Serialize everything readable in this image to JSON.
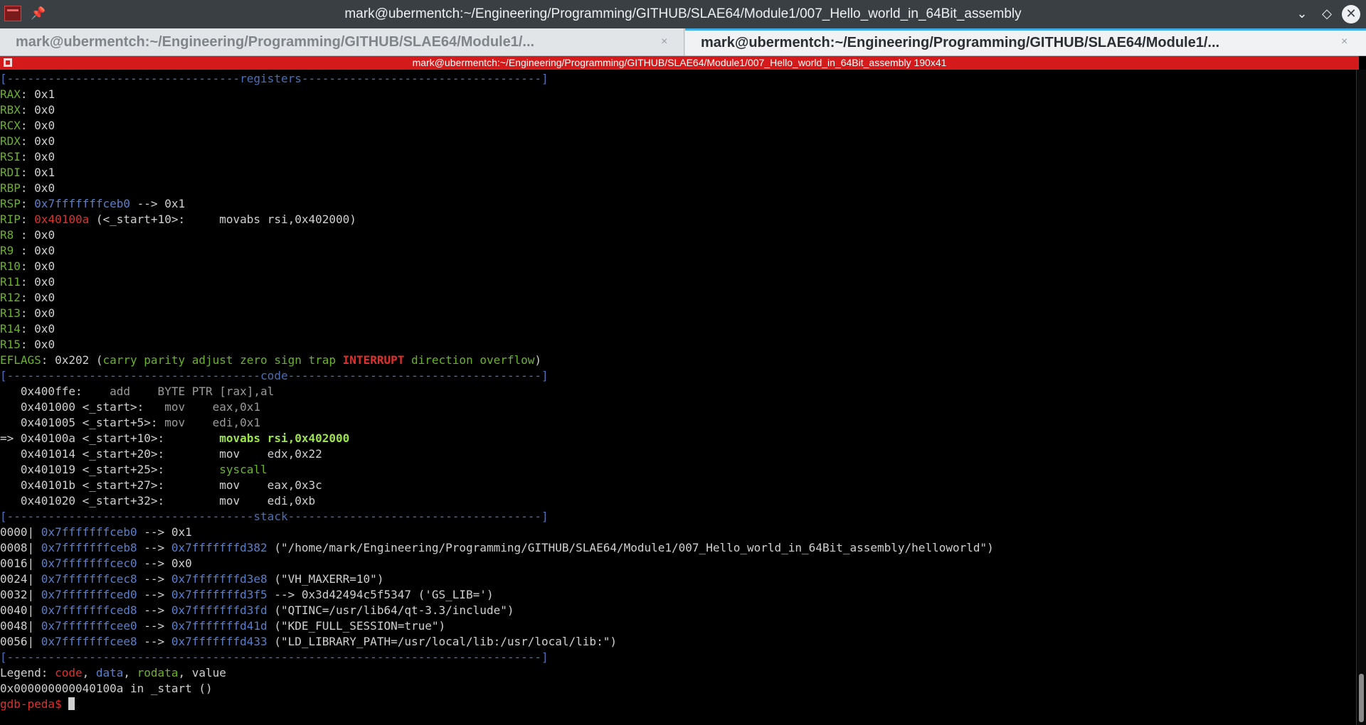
{
  "window": {
    "title": "mark@ubermentch:~/Engineering/Programming/GITHUB/SLAE64/Module1/007_Hello_world_in_64Bit_assembly"
  },
  "tabs": [
    {
      "label": "mark@ubermentch:~/Engineering/Programming/GITHUB/SLAE64/Module1/...",
      "close": "×"
    },
    {
      "label": "mark@ubermentch:~/Engineering/Programming/GITHUB/SLAE64/Module1/...",
      "close": "×"
    }
  ],
  "session": {
    "title": "mark@ubermentch:~/Engineering/Programming/GITHUB/SLAE64/Module1/007_Hello_world_in_64Bit_assembly 190x41"
  },
  "terminal": {
    "sep_registers": "[----------------------------------registers-----------------------------------]",
    "registers": [
      {
        "name": "RAX",
        "value": "0x1"
      },
      {
        "name": "RBX",
        "value": "0x0"
      },
      {
        "name": "RCX",
        "value": "0x0"
      },
      {
        "name": "RDX",
        "value": "0x0"
      },
      {
        "name": "RSI",
        "value": "0x0"
      },
      {
        "name": "RDI",
        "value": "0x1"
      },
      {
        "name": "RBP",
        "value": "0x0"
      }
    ],
    "rsp": {
      "name": "RSP",
      "addr": "0x7fffffffceb0",
      "rest": " --> 0x1"
    },
    "rip": {
      "name": "RIP",
      "addr": "0x40100a",
      "rest": " (<_start+10>:     movabs rsi,0x402000)"
    },
    "registers2": [
      {
        "name": "R8 ",
        "value": "0x0"
      },
      {
        "name": "R9 ",
        "value": "0x0"
      },
      {
        "name": "R10",
        "value": "0x0"
      },
      {
        "name": "R11",
        "value": "0x0"
      },
      {
        "name": "R12",
        "value": "0x0"
      },
      {
        "name": "R13",
        "value": "0x0"
      },
      {
        "name": "R14",
        "value": "0x0"
      },
      {
        "name": "R15",
        "value": "0x0"
      }
    ],
    "eflags": {
      "name": "EFLAGS",
      "value": ": 0x202 (",
      "flags_a": "carry parity adjust zero sign trap",
      "flag_hl": "INTERRUPT",
      "flags_b": "direction overflow",
      "close": ")"
    },
    "sep_code": "[-------------------------------------code-------------------------------------]",
    "code": [
      {
        "prefix": "   0x400ffe:    ",
        "instr": "add    BYTE PTR [rax],al",
        "style": "gray"
      },
      {
        "prefix": "   0x401000 <_start>:   ",
        "instr": "mov    eax,0x1",
        "style": "gray"
      },
      {
        "prefix": "   0x401005 <_start+5>: ",
        "instr": "mov    edi,0x1",
        "style": "gray"
      },
      {
        "prefix": "=> 0x40100a <_start+10>:        ",
        "instr": "movabs rsi,0x402000",
        "style": "hl"
      },
      {
        "prefix": "   0x401014 <_start+20>:        ",
        "instr": "mov    edx,0x22",
        "style": "plain"
      },
      {
        "prefix": "   0x401019 <_start+25>:        ",
        "instr": "syscall",
        "style": "grn"
      },
      {
        "prefix": "   0x40101b <_start+27>:        ",
        "instr": "mov    eax,0x3c",
        "style": "plain"
      },
      {
        "prefix": "   0x401020 <_start+32>:        ",
        "instr": "mov    edi,0xb",
        "style": "plain"
      }
    ],
    "sep_stack": "[------------------------------------stack-------------------------------------]",
    "stack": [
      {
        "off": "0000| ",
        "addr": "0x7fffffffceb0",
        "arrow": " --> ",
        "ptr": "",
        "rest": "0x1"
      },
      {
        "off": "0008| ",
        "addr": "0x7fffffffceb8",
        "arrow": " --> ",
        "ptr": "0x7fffffffd382",
        "rest": " (\"/home/mark/Engineering/Programming/GITHUB/SLAE64/Module1/007_Hello_world_in_64Bit_assembly/helloworld\")"
      },
      {
        "off": "0016| ",
        "addr": "0x7fffffffcec0",
        "arrow": " --> ",
        "ptr": "",
        "rest": "0x0"
      },
      {
        "off": "0024| ",
        "addr": "0x7fffffffcec8",
        "arrow": " --> ",
        "ptr": "0x7fffffffd3e8",
        "rest": " (\"VH_MAXERR=10\")"
      },
      {
        "off": "0032| ",
        "addr": "0x7fffffffced0",
        "arrow": " --> ",
        "ptr": "0x7fffffffd3f5",
        "rest": " --> 0x3d42494c5f5347 ('GS_LIB=')"
      },
      {
        "off": "0040| ",
        "addr": "0x7fffffffced8",
        "arrow": " --> ",
        "ptr": "0x7fffffffd3fd",
        "rest": " (\"QTINC=/usr/lib64/qt-3.3/include\")"
      },
      {
        "off": "0048| ",
        "addr": "0x7fffffffcee0",
        "arrow": " --> ",
        "ptr": "0x7fffffffd41d",
        "rest": " (\"KDE_FULL_SESSION=true\")"
      },
      {
        "off": "0056| ",
        "addr": "0x7fffffffcee8",
        "arrow": " --> ",
        "ptr": "0x7fffffffd433",
        "rest": " (\"LD_LIBRARY_PATH=/usr/local/lib:/usr/local/lib:\")"
      }
    ],
    "sep_end": "[------------------------------------------------------------------------------]",
    "legend": {
      "label": "Legend: ",
      "code": "code",
      "c1": ", ",
      "data": "data",
      "c2": ", ",
      "rodata": "rodata",
      "c3": ", value"
    },
    "location": "0x000000000040100a in _start ()",
    "prompt": "gdb-peda$ "
  },
  "colors": {
    "accent": "#3daee9",
    "session_bar": "#d41a1a",
    "register": "#6bb32a",
    "address": "#5a7fcf"
  }
}
